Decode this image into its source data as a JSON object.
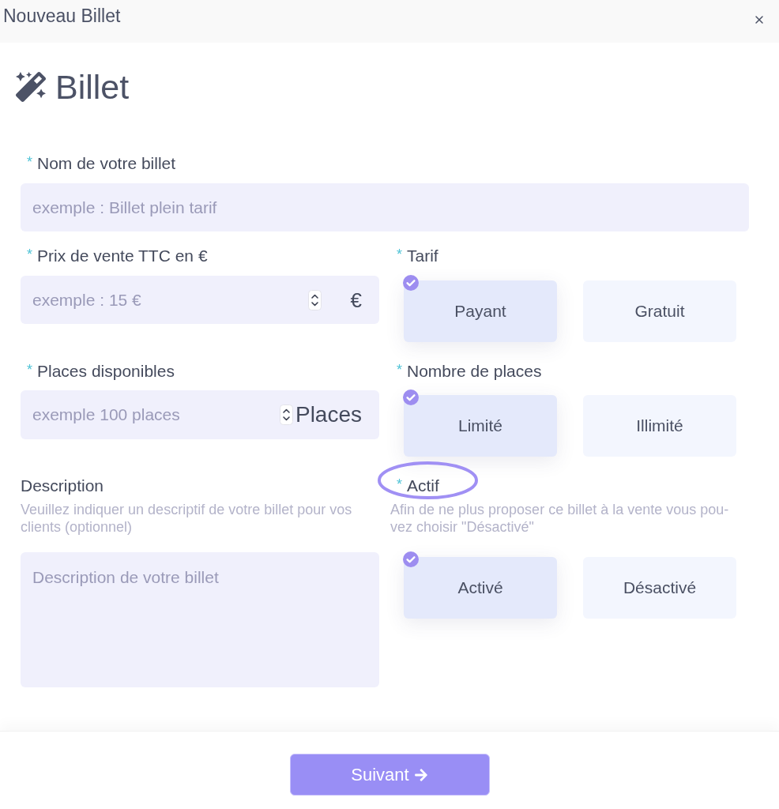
{
  "window": {
    "title": "Nouveau Billet"
  },
  "section": {
    "title": "Billet"
  },
  "name_field": {
    "required_mark": "*",
    "label": "Nom de votre billet",
    "placeholder": "exemple : Billet plein tarif"
  },
  "price_field": {
    "required_mark": "*",
    "label": "Prix de vente TTC en €",
    "placeholder": "exemple : 15 €",
    "unit": "€"
  },
  "tarif": {
    "required_mark": "*",
    "label": "Tarif",
    "options": [
      {
        "label": "Payant",
        "selected": true
      },
      {
        "label": "Gratuit",
        "selected": false
      }
    ]
  },
  "places_field": {
    "required_mark": "*",
    "label": "Places disponibles",
    "placeholder": "exemple 100 places",
    "unit": "Places"
  },
  "places_mode": {
    "required_mark": "*",
    "label": "Nombre de places",
    "options": [
      {
        "label": "Limité",
        "selected": true
      },
      {
        "label": "Illimité",
        "selected": false
      }
    ]
  },
  "description": {
    "label": "Description",
    "help": "Veuillez indiquer un descriptif de votre billet pour vos clients (optionnel)",
    "placeholder": "Description de votre billet"
  },
  "actif": {
    "required_mark": "*",
    "label": "Actif",
    "circled": true,
    "help_lines": [
      "Afin de ne plus proposer ce billet à la vente vous pou-",
      "vez choisir \"Désactivé\""
    ],
    "options": [
      {
        "label": "Activé",
        "selected": true
      },
      {
        "label": "Désactivé",
        "selected": false
      }
    ]
  },
  "footer": {
    "next_button": "Suivant"
  }
}
